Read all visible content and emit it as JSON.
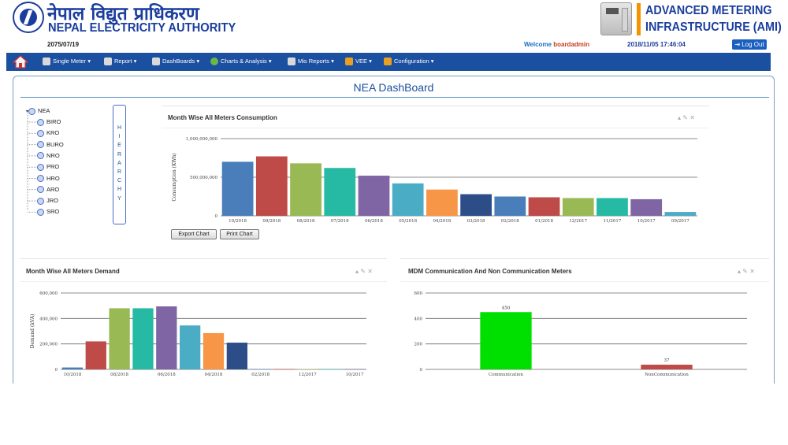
{
  "header": {
    "org_name_np": "नेपाल विद्युत प्राधिकरण",
    "org_name_en": "NEPAL ELECTRICITY AUTHORITY",
    "nepali_date": "2075/07/19",
    "ami_line1": "ADVANCED METERING",
    "ami_line2": "INFRASTRUCTURE (AMI)",
    "welcome_prefix": "Welcome",
    "username": "boardadmin",
    "datetime": "2018/11/05 17:46:04",
    "logout_label": "Log Out"
  },
  "nav": {
    "home_icon": "home-icon",
    "items": [
      {
        "label": "Single Meter",
        "icon": "meter-icon",
        "color": "#d9d9d9"
      },
      {
        "label": "Report",
        "icon": "report-icon",
        "color": "#d9d9d9"
      },
      {
        "label": "DashBoards",
        "icon": "dashboard-icon",
        "color": "#d9d9d9"
      },
      {
        "label": "Charts & Analysis",
        "icon": "chart-icon",
        "color": "#6cb64a"
      },
      {
        "label": "Mis Reports",
        "icon": "mis-icon",
        "color": "#d9d9d9"
      },
      {
        "label": "VEE",
        "icon": "vee-icon",
        "color": "#e8a020"
      },
      {
        "label": "Configuration",
        "icon": "config-icon",
        "color": "#e8a020"
      }
    ]
  },
  "dashboard": {
    "title": "NEA DashBoard",
    "hierarchy_label": "HIERARCHY",
    "tree": {
      "root": "NEA",
      "children": [
        "BIRO",
        "KRO",
        "BURO",
        "NRO",
        "PRO",
        "HRO",
        "ARO",
        "JRO",
        "SRO"
      ]
    }
  },
  "buttons": {
    "export": "Export Chart",
    "print": "Print Chart"
  },
  "panels": {
    "consumption": {
      "title": "Month Wise All Meters Consumption"
    },
    "demand": {
      "title": "Month Wise All Meters Demand"
    },
    "mdm": {
      "title": "MDM Communication And Non Communication Meters"
    }
  },
  "chart_data": [
    {
      "type": "bar",
      "title": "Month Wise All Meters Consumption",
      "ylabel": "Consumption (KWh)",
      "ylim": [
        0,
        1000000000
      ],
      "yticks": [
        "0",
        "500,000,000",
        "1,000,000,000"
      ],
      "categories": [
        "10/2018",
        "09/2018",
        "08/2018",
        "07/2018",
        "06/2018",
        "05/2018",
        "04/2018",
        "03/2018",
        "02/2018",
        "01/2018",
        "12/2017",
        "11/2017",
        "10/2017",
        "09/2017"
      ],
      "values": [
        700000000,
        770000000,
        680000000,
        620000000,
        520000000,
        420000000,
        340000000,
        280000000,
        250000000,
        240000000,
        230000000,
        230000000,
        215000000,
        50000000
      ],
      "colors": [
        "#4a7ebb",
        "#be4b48",
        "#98b954",
        "#26b9a3",
        "#7f65a4",
        "#4aacc5",
        "#f79646",
        "#2c4d87",
        "#4a7ebb",
        "#be4b48",
        "#98b954",
        "#26b9a3",
        "#7f65a4",
        "#4aacc5"
      ],
      "grid": true
    },
    {
      "type": "bar",
      "title": "Month Wise All Meters Demand",
      "ylabel": "Demand (kVA)",
      "ylim": [
        0,
        600000
      ],
      "yticks": [
        "0",
        "200,000",
        "400,000",
        "600,000"
      ],
      "categories": [
        "10/2018",
        "09/2018",
        "08/2018",
        "07/2018",
        "06/2018",
        "05/2018",
        "04/2018",
        "03/2018",
        "02/2018",
        "01/2018",
        "12/2017",
        "11/2017",
        "10/2017"
      ],
      "tick_labels": [
        "10/2018",
        "",
        "08/2018",
        "",
        "06/2018",
        "",
        "04/2018",
        "",
        "02/2018",
        "",
        "12/2017",
        "",
        "10/2017"
      ],
      "values": [
        15000,
        220000,
        480000,
        480000,
        495000,
        345000,
        285000,
        210000,
        3000,
        3000,
        3000,
        3000,
        3000
      ],
      "colors": [
        "#4a7ebb",
        "#be4b48",
        "#98b954",
        "#26b9a3",
        "#7f65a4",
        "#4aacc5",
        "#f79646",
        "#2c4d87",
        "#4a7ebb",
        "#be4b48",
        "#98b954",
        "#26b9a3",
        "#7f65a4"
      ],
      "grid": true
    },
    {
      "type": "bar",
      "title": "MDM Communication And Non Communication Meters",
      "ylim": [
        0,
        600
      ],
      "yticks": [
        "0",
        "200",
        "400",
        "600"
      ],
      "categories": [
        "Communication",
        "NonCommunication"
      ],
      "values": [
        450,
        37
      ],
      "data_labels": [
        "450",
        "37"
      ],
      "colors": [
        "#00e000",
        "#be4b48"
      ],
      "grid": true
    }
  ]
}
